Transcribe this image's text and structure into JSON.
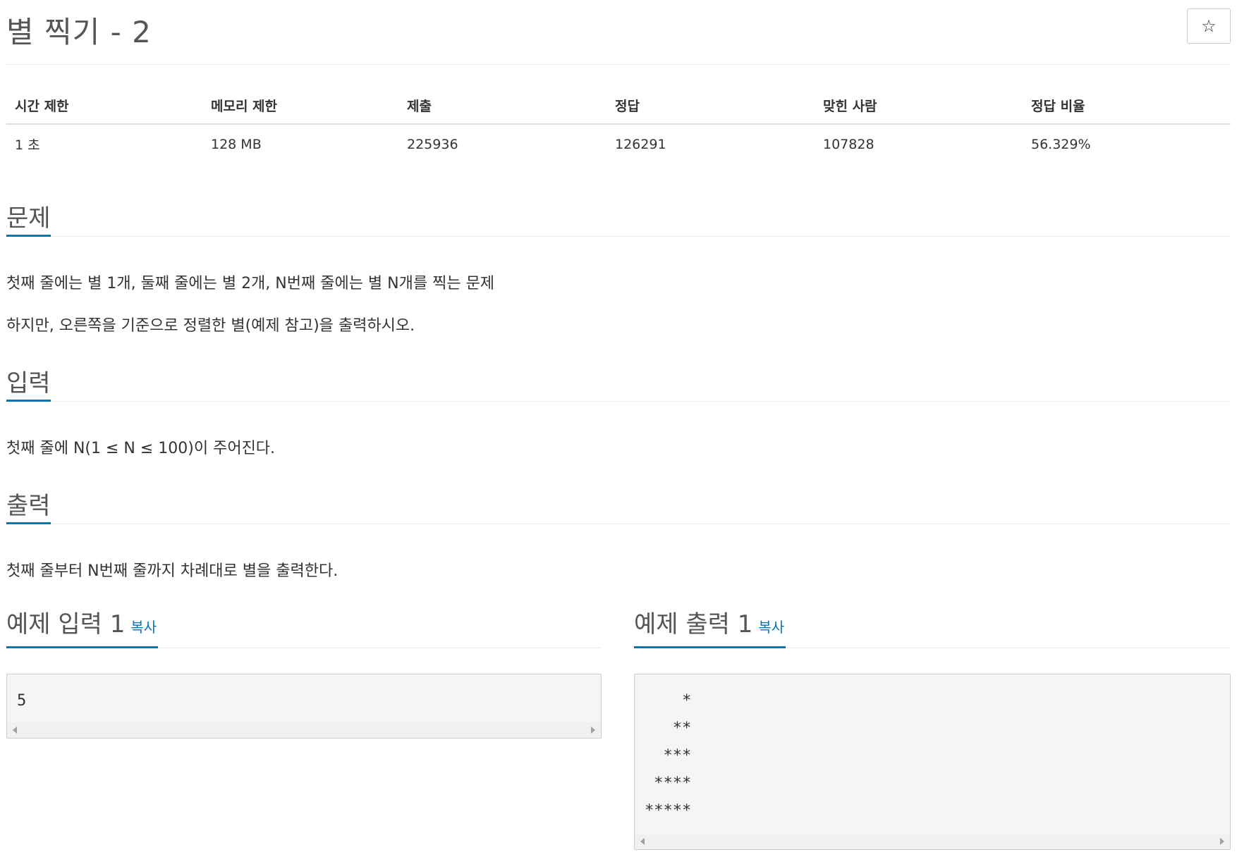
{
  "title": "별 찍기 - 2",
  "star_icon": "☆",
  "info": {
    "headers": [
      "시간 제한",
      "메모리 제한",
      "제출",
      "정답",
      "맞힌 사람",
      "정답 비율"
    ],
    "values": [
      "1 초",
      "128 MB",
      "225936",
      "126291",
      "107828",
      "56.329%"
    ]
  },
  "problem": {
    "heading": "문제",
    "line1": "첫째 줄에는 별 1개, 둘째 줄에는 별 2개, N번째 줄에는 별 N개를 찍는 문제",
    "line2": "하지만, 오른쪽을 기준으로 정렬한 별(예제 참고)을 출력하시오."
  },
  "input": {
    "heading": "입력",
    "text": "첫째 줄에 N(1 ≤ N ≤ 100)이 주어진다."
  },
  "output": {
    "heading": "출력",
    "text": "첫째 줄부터 N번째 줄까지 차례대로 별을 출력한다."
  },
  "sample_input": {
    "heading": "예제 입력 1",
    "copy_label": "복사",
    "content": "5"
  },
  "sample_output": {
    "heading": "예제 출력 1",
    "copy_label": "복사",
    "content": "    *\n   **\n  ***\n ****\n*****"
  }
}
